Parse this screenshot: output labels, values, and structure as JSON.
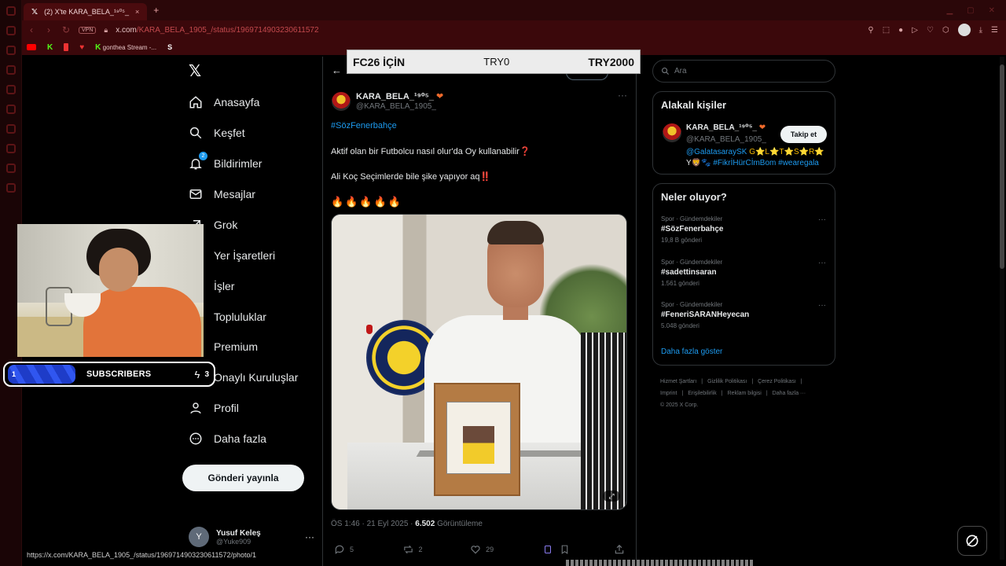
{
  "browser": {
    "tab_title": "(2) X'te KARA_BELA_¹⁹⁰⁵_",
    "tab_close": "×",
    "new_tab": "+",
    "vpn": "VPN",
    "url_host": "x.com",
    "url_path": "/KARA_BELA_1905_/status/1969714903230611572",
    "bookmark_label": "gonthea Stream -...",
    "status_url": "https://x.com/KARA_BELA_1905_/status/1969714903230611572/photo/1"
  },
  "overlay": {
    "banner_left": "FC26 İÇİN",
    "banner_mid": "TRY0",
    "banner_right": "TRY2000",
    "subs_count": "1",
    "subs_label": "SUBSCRIBERS",
    "subs_goal": "3"
  },
  "nav": {
    "items": [
      {
        "label": "Anasayfa",
        "icon": "home-icon"
      },
      {
        "label": "Keşfet",
        "icon": "search-icon"
      },
      {
        "label": "Bildirimler",
        "icon": "bell-icon",
        "badge": "2"
      },
      {
        "label": "Mesajlar",
        "icon": "mail-icon"
      },
      {
        "label": "Grok",
        "icon": "grok-icon"
      },
      {
        "label": "Yer İşaretleri",
        "icon": "bookmark-icon"
      },
      {
        "label": "İşler",
        "icon": "briefcase-icon"
      },
      {
        "label": "Topluluklar",
        "icon": "communities-icon"
      },
      {
        "label": "Premium",
        "icon": "x-premium-icon"
      },
      {
        "label": "Onaylı Kuruluşlar",
        "icon": "verified-org-icon"
      },
      {
        "label": "Profil",
        "icon": "person-icon"
      },
      {
        "label": "Daha fazla",
        "icon": "more-circle-icon"
      }
    ],
    "post_button": "Gönderi yayınla",
    "me_initial": "Y",
    "me_name": "Yusuf Keleş",
    "me_handle": "@Yuke909"
  },
  "tweet": {
    "author_name": "KARA_BELA_¹⁹⁰⁵_",
    "author_handle": "@KARA_BELA_1905_",
    "hashtag": "#SözFenerbahçe",
    "line1": "Aktif olan bir Futbolcu nasıl olur'da Oy kullanabilir",
    "line1_mark": "❓",
    "line2": "Ali Koç Seçimlerde bile şike yapıyor aq",
    "line2_mark": "‼️",
    "fires": [
      "🔥",
      "🔥",
      "🔥",
      "🔥",
      "🔥"
    ],
    "time": "ÖS 1:46 · 21 Eyl 2025 · ",
    "views": "6.502",
    "views_label": " Görüntüleme",
    "replies": "5",
    "reposts": "2",
    "likes": "29"
  },
  "right": {
    "search_placeholder": "Ara",
    "related_title": "Alakalı kişiler",
    "related": {
      "name": "KARA_BELA_¹⁹⁰⁵_",
      "handle": "@KARA_BELA_1905_",
      "follow": "Takip et",
      "bio_link": "@GalatasaraySK",
      "bio_mid": " G⭐L⭐T⭐S⭐R⭐",
      "bio_y": "Y🦁🐾 ",
      "bio_tags": "#FikrİHürCİmBom #wearegala"
    },
    "trends_title": "Neler oluyor?",
    "trends": [
      {
        "category": "Spor · Gündemdekiler",
        "tag": "#SözFenerbahçe",
        "count": "19,8 B gönderi"
      },
      {
        "category": "Spor · Gündemdekiler",
        "tag": "#sadettinsaran",
        "count": "1.561 gönderi"
      },
      {
        "category": "Spor · Gündemdekiler",
        "tag": "#FeneriSARANHeyecan",
        "count": "5.048 gönderi"
      }
    ],
    "show_more": "Daha fazla göster",
    "footer": [
      "Hizmet Şartları",
      "|",
      "Gizlilik Politikası",
      "|",
      "Çerez Politikası",
      "|",
      "Imprint",
      "|",
      "Erişilebilirlik",
      "|",
      "Reklam bilgisi",
      "|",
      "Daha fazla ···",
      "© 2025 X Corp."
    ]
  }
}
